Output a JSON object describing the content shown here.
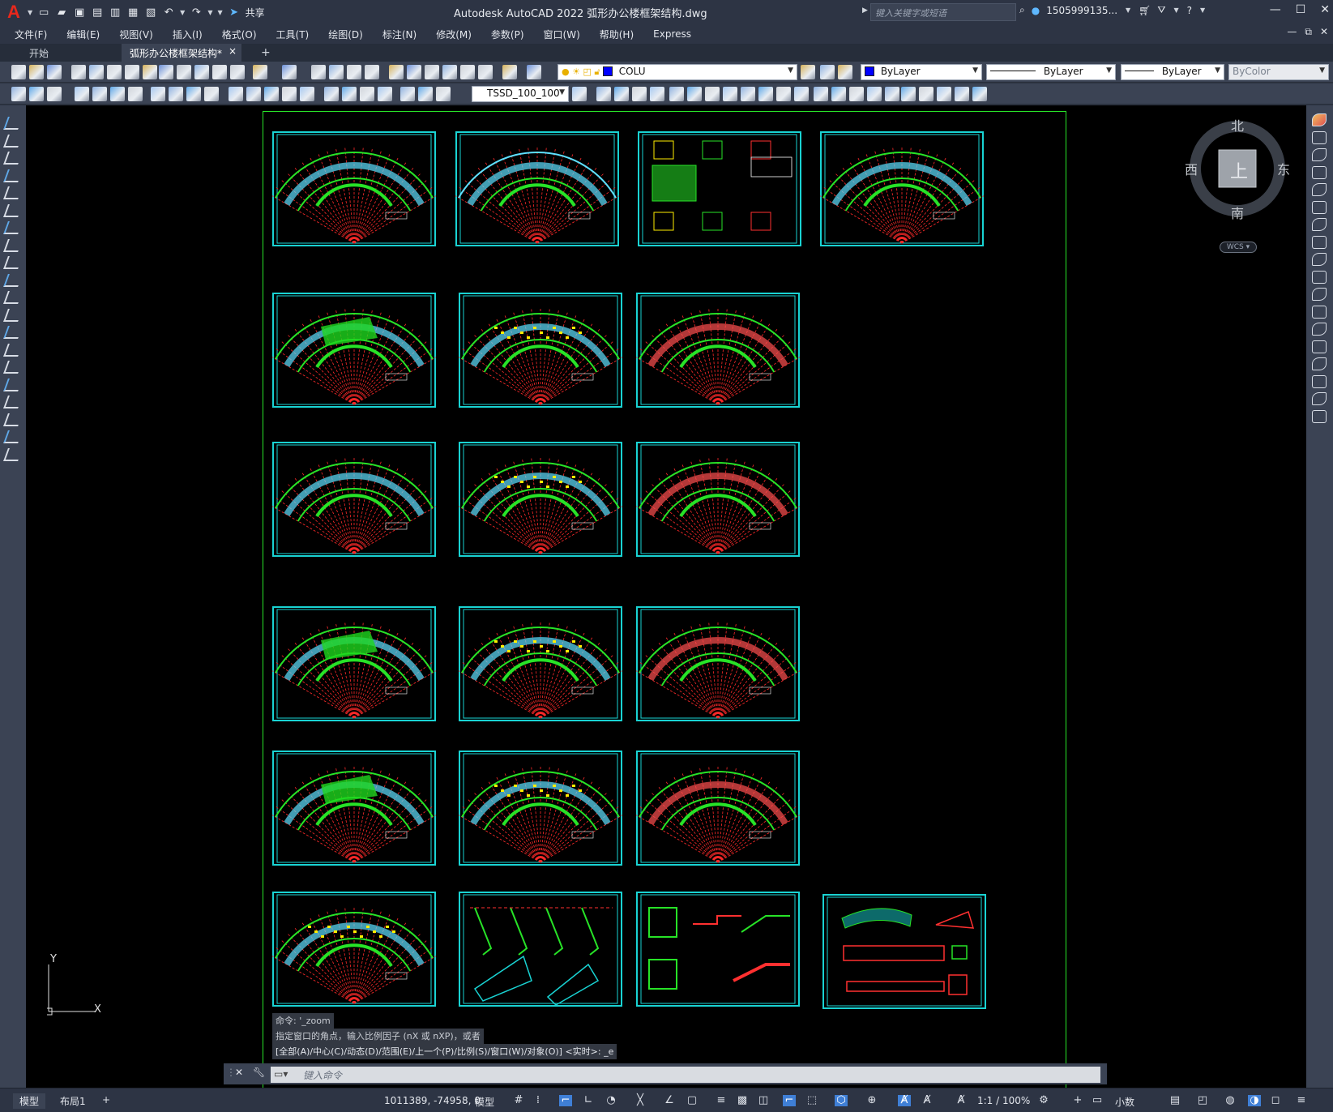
{
  "app": {
    "title": "Autodesk AutoCAD 2022    弧形办公楼框架结构.dwg",
    "logo": "A",
    "share_label": "共享",
    "search_placeholder": "键入关键字或短语",
    "user": "1505999135...",
    "accent_color": "#e8281c"
  },
  "menus": [
    "文件(F)",
    "编辑(E)",
    "视图(V)",
    "插入(I)",
    "格式(O)",
    "工具(T)",
    "绘图(D)",
    "标注(N)",
    "修改(M)",
    "参数(P)",
    "窗口(W)",
    "帮助(H)",
    "Express"
  ],
  "tabs": {
    "start": "开始",
    "document": "弧形办公楼框架结构*",
    "close": "×",
    "add": "+"
  },
  "toolbar": {
    "layer_value": "COLU",
    "color_value": "ByLayer",
    "linetype_value": "ByLayer",
    "lineweight_value": "ByLayer",
    "plotstyle_value": "ByColor",
    "dimstyle_value": "TSSD_100_100"
  },
  "viewcube": {
    "north": "北",
    "south": "南",
    "east": "东",
    "west": "西",
    "face": "上",
    "wcs_label": "WCS"
  },
  "ucs": {
    "x_label": "X",
    "y_label": "Y"
  },
  "command": {
    "history": [
      "命令: '_zoom",
      "指定窗口的角点，输入比例因子 (nX 或 nXP)，或者",
      "[全部(A)/中心(C)/动态(D)/范围(E)/上一个(P)/比例(S)/窗口(W)/对象(O)] <实时>: _e"
    ],
    "placeholder": "键入命令"
  },
  "statusbar": {
    "model_tab": "模型",
    "layout_tab": "布局1",
    "add_tab": "+",
    "coordinates": "1011389, -74958, 0",
    "model_space": "模型",
    "annotation_scale": "1:1 / 100%",
    "units": "小数"
  },
  "colors": {
    "canvas": "#000000",
    "sheet_frame": "#27e327",
    "drawing_border": "#19d3d3",
    "ui_dark": "#2d3444",
    "ui_panel": "#3b4354"
  }
}
